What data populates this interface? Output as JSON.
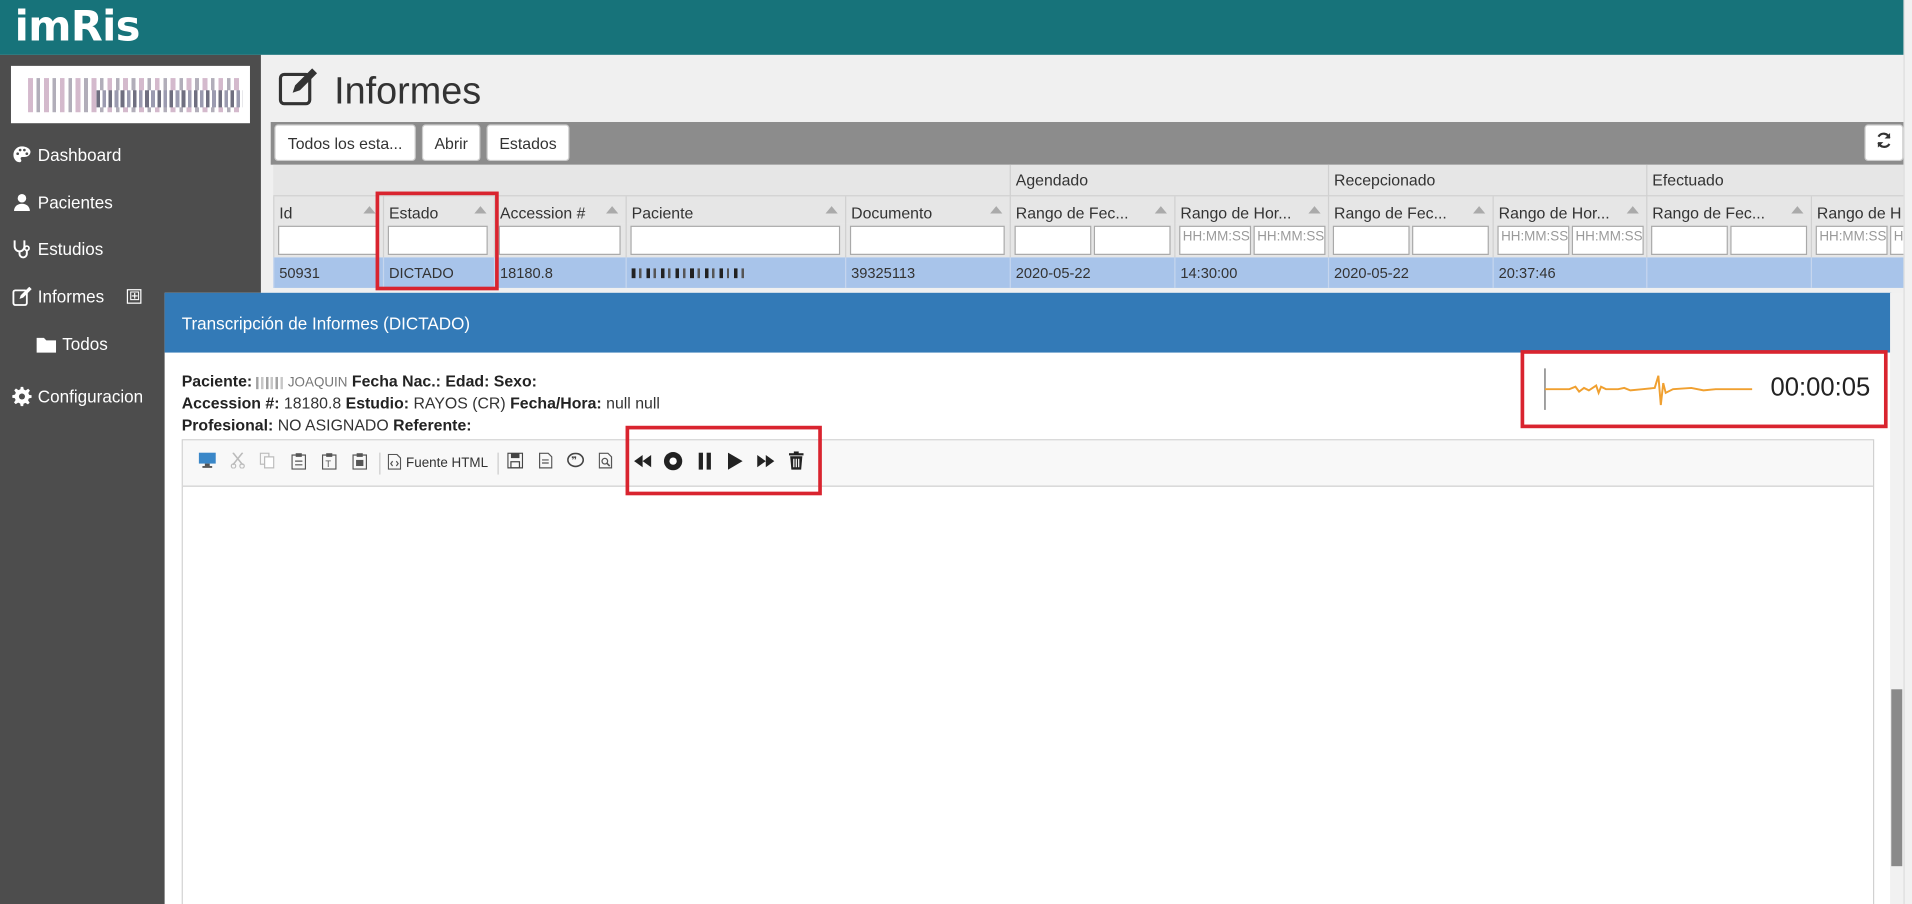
{
  "app": {
    "brand": "imRis"
  },
  "sidebar": {
    "items": [
      {
        "label": "Dashboard",
        "icon": "palette-icon"
      },
      {
        "label": "Pacientes",
        "icon": "user-icon"
      },
      {
        "label": "Estudios",
        "icon": "stethoscope-icon"
      },
      {
        "label": "Informes",
        "icon": "edit-icon",
        "expand": "⊞"
      },
      {
        "label": "Todos",
        "icon": "folder-icon"
      },
      {
        "label": "Configuracion",
        "icon": "gear-icon"
      }
    ]
  },
  "page": {
    "title": "Informes"
  },
  "toolbar": {
    "filter_button": "Todos los esta...",
    "open_button": "Abrir",
    "states_button": "Estados"
  },
  "grid": {
    "groups": {
      "agendado": "Agendado",
      "recepcionado": "Recepcionado",
      "efectuado": "Efectuado"
    },
    "columns": {
      "id": "Id",
      "estado": "Estado",
      "accession": "Accession #",
      "paciente": "Paciente",
      "documento": "Documento",
      "ag_fecha": "Rango de Fec...",
      "ag_hora": "Rango de Hor...",
      "re_fecha": "Rango de Fec...",
      "re_hora": "Rango de Hor...",
      "ef_fecha": "Rango de Fec...",
      "ef_hora": "Rango de H"
    },
    "time_placeholder": "HH:MM:SS",
    "row": {
      "id": "50931",
      "estado": "DICTADO",
      "accession": "18180.8",
      "documento": "39325113",
      "ag_fecha": "2020-05-22",
      "ag_hora": "14:30:00",
      "re_fecha": "2020-05-22",
      "re_hora": "20:37:46"
    }
  },
  "modal": {
    "title": "Transcripción de Informes (DICTADO)",
    "labels": {
      "paciente": "Paciente:",
      "fecha_nac": "Fecha Nac.:",
      "edad": "Edad:",
      "sexo": "Sexo:",
      "accession": "Accession #:",
      "estudio": "Estudio:",
      "fecha_hora": "Fecha/Hora:",
      "profesional": "Profesional:",
      "referente": "Referente:"
    },
    "values": {
      "paciente_name": "JOAQUIN",
      "accession": "18180.8",
      "estudio": "RAYOS (CR)",
      "fecha_hora": "null null",
      "profesional": "NO ASIGNADO"
    },
    "audio": {
      "elapsed": "00:00:05",
      "wave_color": "#f0a030"
    },
    "editor": {
      "source_label": "Fuente HTML"
    }
  },
  "colors": {
    "topbar": "#17737a",
    "sidebar": "#4d4d4d",
    "modal_header": "#337ab7",
    "selected_row": "#a8c4ea",
    "highlight": "#d9242f"
  }
}
